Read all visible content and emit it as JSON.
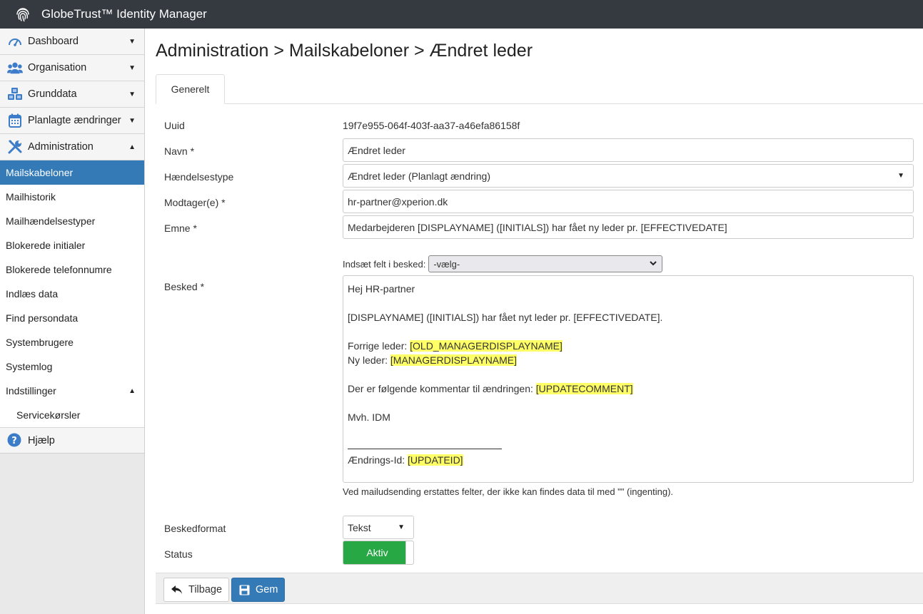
{
  "app": {
    "title": "GlobeTrust™ Identity Manager"
  },
  "sidebar": {
    "top_items": [
      {
        "label": "Dashboard",
        "icon": "dashboard-gauge-icon",
        "expanded": false
      },
      {
        "label": "Organisation",
        "icon": "users-icon",
        "expanded": false
      },
      {
        "label": "Grunddata",
        "icon": "cubes-icon",
        "expanded": false
      },
      {
        "label": "Planlagte ændringer",
        "icon": "calendar-icon",
        "expanded": false
      },
      {
        "label": "Administration",
        "icon": "tools-icon",
        "expanded": true
      }
    ],
    "admin_items": [
      "Mailskabeloner",
      "Mailhistorik",
      "Mailhændelsestyper",
      "Blokerede initialer",
      "Blokerede telefonnumre",
      "Indlæs data",
      "Find persondata",
      "Systembrugere",
      "Systemlog"
    ],
    "settings": {
      "label": "Indstillinger",
      "children": [
        "Servicekørsler"
      ]
    },
    "help": {
      "label": "Hjælp",
      "icon": "question-circle-icon"
    },
    "active_item": "Mailskabeloner"
  },
  "page": {
    "breadcrumb": "Administration > Mailskabeloner > Ændret leder",
    "tabs": [
      "Generelt"
    ]
  },
  "form": {
    "uuid": {
      "label": "Uuid",
      "value": "19f7e955-064f-403f-aa37-a46efa86158f"
    },
    "navn": {
      "label": "Navn *",
      "value": "Ændret leder"
    },
    "haendelsestype": {
      "label": "Hændelsestype",
      "value": "Ændret leder (Planlagt ændring)"
    },
    "modtager": {
      "label": "Modtager(e) *",
      "value": "hr-partner@xperion.dk"
    },
    "emne": {
      "label": "Emne *",
      "value": "Medarbejderen [DISPLAYNAME] ([INITIALS]) har fået ny leder pr. [EFFECTIVEDATE]"
    },
    "insert_field": {
      "label": "Indsæt felt i besked:",
      "value": "-vælg-"
    },
    "besked": {
      "label": "Besked *",
      "line1": "Hej HR-partner",
      "line2": "[DISPLAYNAME] ([INITIALS]) har fået nyt leder pr. [EFFECTIVEDATE].",
      "forrige_prefix": "Forrige leder: ",
      "forrige_field": "[OLD_MANAGERDISPLAYNAME]",
      "ny_prefix": "Ny leder: ",
      "ny_field": "[MANAGERDISPLAYNAME]",
      "comment_prefix": "Der er følgende kommentar til ændringen: ",
      "comment_field": "[UPDATECOMMENT]",
      "signoff": "Mvh. IDM",
      "id_prefix": "Ændrings-Id: ",
      "id_field": "[UPDATEID]"
    },
    "note": "Ved mailudsending erstattes felter, der ikke kan findes data til med \"\" (ingenting).",
    "beskedformat": {
      "label": "Beskedformat",
      "value": "Tekst"
    },
    "status": {
      "label": "Status",
      "value": "Aktiv"
    }
  },
  "footer": {
    "back_label": "Tilbage",
    "save_label": "Gem"
  },
  "colors": {
    "topbar": "#343a40",
    "active": "#337ab7",
    "toggle_on": "#28a745",
    "highlight": "#ffff66"
  }
}
